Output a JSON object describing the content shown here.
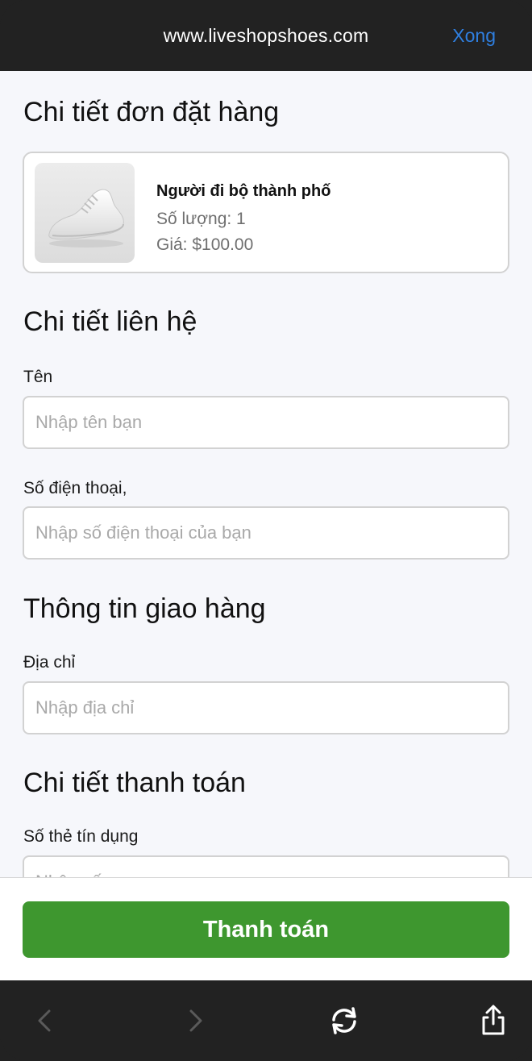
{
  "browser": {
    "url": "www.liveshopshoes.com",
    "done_label": "Xong"
  },
  "order": {
    "heading": "Chi tiết đơn đặt hàng",
    "product": {
      "name": "Người đi bộ thành phố",
      "quantity": "Số lượng: 1",
      "price": "Giá: $100.00"
    }
  },
  "contact": {
    "heading": "Chi tiết liên hệ",
    "name_label": "Tên",
    "name_placeholder": "Nhập tên bạn",
    "phone_label": "Số điện thoại,",
    "phone_placeholder": "Nhập số điện thoại của bạn"
  },
  "shipping": {
    "heading": "Thông tin giao hàng",
    "address_label": "Địa chỉ",
    "address_placeholder": "Nhập địa chỉ"
  },
  "payment": {
    "heading": "Chi tiết thanh toán",
    "card_label": "Số thẻ tín dụng",
    "card_placeholder": "Nhập số"
  },
  "footer": {
    "pay_label": "Thanh toán"
  },
  "colors": {
    "accent": "#2f7fe0",
    "pay_button": "#3e972f"
  },
  "icons": [
    "back-icon",
    "forward-icon",
    "reload-icon",
    "share-icon"
  ]
}
